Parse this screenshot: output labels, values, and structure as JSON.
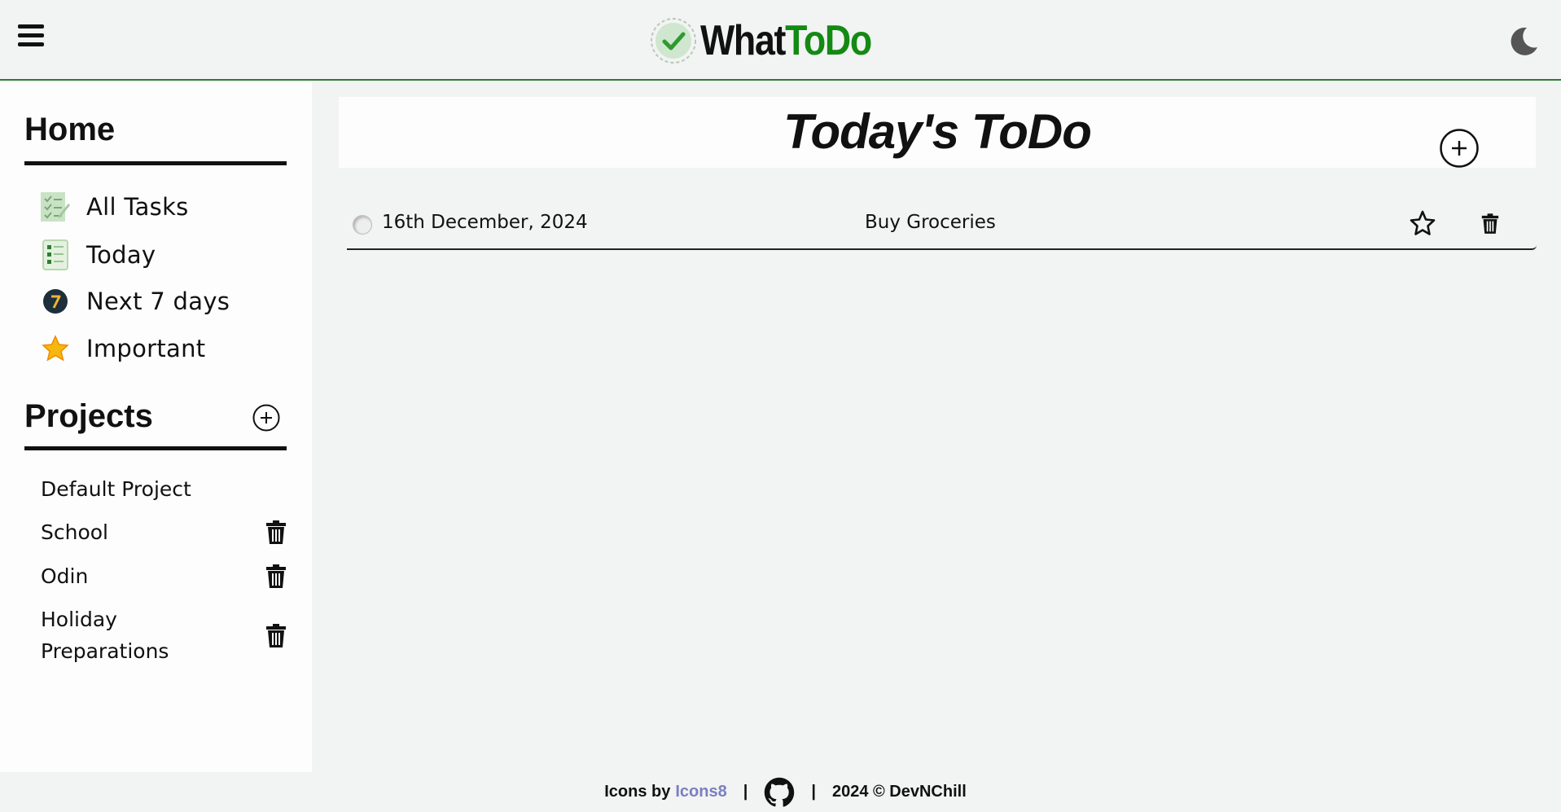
{
  "header": {
    "brand_part1": "What",
    "brand_part2": "ToDo",
    "colors": {
      "brand_green": "#138a13",
      "accent_border": "#2e7d32"
    },
    "icons": {
      "menu": "hamburger-icon",
      "logo": "checkmark-badge-icon",
      "theme": "moon-icon"
    }
  },
  "sidebar": {
    "home_title": "Home",
    "nav": [
      {
        "label": "All Tasks",
        "icon": "task-list-icon"
      },
      {
        "label": "Today",
        "icon": "checklist-icon"
      },
      {
        "label": "Next 7 days",
        "icon": "seven-badge-icon"
      },
      {
        "label": "Important",
        "icon": "star-icon"
      }
    ],
    "projects_title": "Projects",
    "projects": [
      {
        "name": "Default Project",
        "deletable": false
      },
      {
        "name": "School",
        "deletable": true
      },
      {
        "name": "Odin",
        "deletable": true
      },
      {
        "name": "Holiday Preparations",
        "deletable": true
      }
    ]
  },
  "main": {
    "title": "Today's ToDo",
    "tasks": [
      {
        "date": "16th December, 2024",
        "name": "Buy Groceries",
        "done": false,
        "important": false
      }
    ]
  },
  "footer": {
    "credit_prefix": "Icons by",
    "credit_link": "Icons8",
    "separator": "|",
    "copyright": "2024 © DevNChill",
    "colors": {
      "link": "#7b7fc0"
    }
  }
}
